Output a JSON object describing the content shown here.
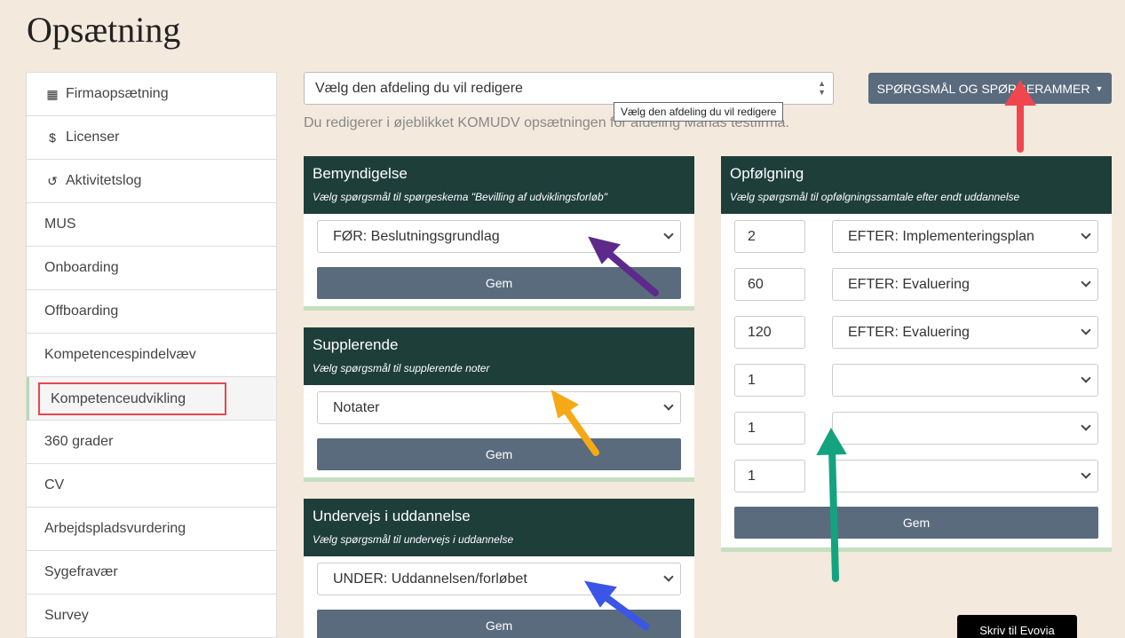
{
  "page": {
    "title": "Opsætning"
  },
  "sidebar": {
    "items": [
      {
        "label": "Firmaopsætning",
        "icon": "building-icon"
      },
      {
        "label": "Licenser",
        "icon": "dollar-icon"
      },
      {
        "label": "Aktivitetslog",
        "icon": "history-icon"
      },
      {
        "label": "MUS"
      },
      {
        "label": "Onboarding"
      },
      {
        "label": "Offboarding"
      },
      {
        "label": "Kompetencespindelvæv"
      },
      {
        "label": "Kompetenceudvikling",
        "active": true,
        "highlighted": true
      },
      {
        "label": "360 grader"
      },
      {
        "label": "CV"
      },
      {
        "label": "Arbejdspladsvurdering"
      },
      {
        "label": "Sygefravær"
      },
      {
        "label": "Survey"
      }
    ]
  },
  "department": {
    "placeholder": "Vælg den afdeling du vil redigere",
    "tooltip": "Vælg den afdeling du vil redigere",
    "info": "Du redigerer i øjeblikket KOMUDV opsætningen for afdeling Marias testfirma."
  },
  "top_button": {
    "label": "SPØRGSMÅL OG SPØRGERAMMER"
  },
  "panels": {
    "bemyndigelse": {
      "title": "Bemyndigelse",
      "subtitle": "Vælg spørgsmål til spørgeskema \"Bevilling af udviklingsforløb\"",
      "selected": "FØR: Beslutningsgrundlag",
      "save": "Gem"
    },
    "supplerende": {
      "title": "Supplerende",
      "subtitle": "Vælg spørgsmål til supplerende noter",
      "selected": "Notater",
      "save": "Gem"
    },
    "undervejs": {
      "title": "Undervejs i uddannelse",
      "subtitle": "Vælg spørgsmål til undervejs i uddannelse",
      "selected": "UNDER: Uddannelsen/forløbet",
      "save": "Gem"
    },
    "opfolgning": {
      "title": "Opfølgning",
      "subtitle": "Vælg spørgsmål til opfølgningssamtale efter endt uddannelse",
      "rows": [
        {
          "days": "2",
          "selected": "EFTER: Implementeringsplan"
        },
        {
          "days": "60",
          "selected": "EFTER: Evaluering"
        },
        {
          "days": "120",
          "selected": "EFTER: Evaluering"
        },
        {
          "days": "1",
          "selected": ""
        },
        {
          "days": "1",
          "selected": ""
        },
        {
          "days": "1",
          "selected": ""
        }
      ],
      "save": "Gem"
    }
  },
  "chat": {
    "label": "Skriv til Evovia"
  },
  "annotation_colors": {
    "red": "#f0474f",
    "purple": "#5d2a8c",
    "orange": "#f5a916",
    "blue": "#3b55e6",
    "teal": "#14a37f"
  }
}
